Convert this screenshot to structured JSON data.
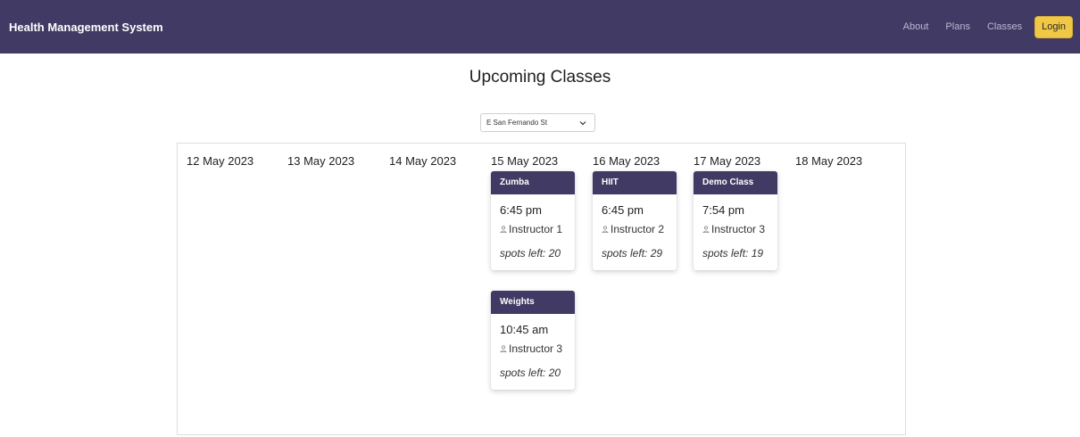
{
  "navbar": {
    "brand": "Health Management System",
    "links": [
      "About",
      "Plans",
      "Classes"
    ],
    "login_label": "Login"
  },
  "page": {
    "title": "Upcoming Classes"
  },
  "location_select": {
    "selected": "E San Fernando St",
    "icon": "chevron-down-icon"
  },
  "days": [
    {
      "label": "12 May 2023",
      "classes": []
    },
    {
      "label": "13 May 2023",
      "classes": []
    },
    {
      "label": "14 May 2023",
      "classes": []
    },
    {
      "label": "15 May 2023",
      "classes": [
        {
          "name": "Zumba",
          "time": "6:45 pm",
          "instructor": "Instructor 1",
          "spots": "spots left: 20"
        },
        {
          "name": "Weights",
          "time": "10:45 am",
          "instructor": "Instructor 3",
          "spots": "spots left: 20"
        }
      ]
    },
    {
      "label": "16 May 2023",
      "classes": [
        {
          "name": "HIIT",
          "time": "6:45 pm",
          "instructor": "Instructor 2",
          "spots": "spots left: 29"
        }
      ]
    },
    {
      "label": "17 May 2023",
      "classes": [
        {
          "name": "Demo Class",
          "time": "7:54 pm",
          "instructor": "Instructor 3",
          "spots": "spots left: 19"
        }
      ]
    },
    {
      "label": "18 May 2023",
      "classes": []
    }
  ],
  "colors": {
    "nav_bg": "#413a64",
    "login_bg": "#f0c845"
  }
}
